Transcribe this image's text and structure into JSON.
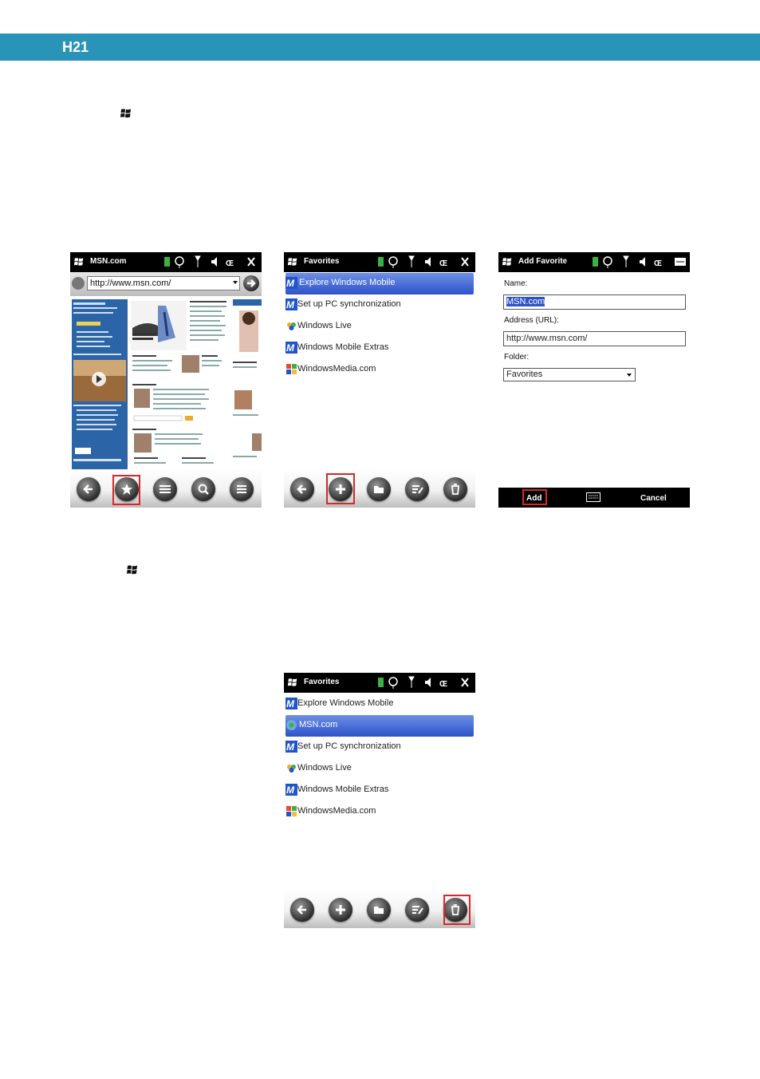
{
  "header": {
    "title": "H21"
  },
  "screen1": {
    "title": "MSN.com",
    "address": "http://www.msn.com/"
  },
  "screen2": {
    "title": "Favorites",
    "items": [
      "Explore Windows Mobile",
      "Set up PC synchronization",
      "Windows Live",
      "Windows Mobile Extras",
      "WindowsMedia.com"
    ]
  },
  "screen3": {
    "title": "Add Favorite",
    "name_label": "Name:",
    "name_value": "MSN.com",
    "address_label": "Address (URL):",
    "address_value": "http://www.msn.com/",
    "folder_label": "Folder:",
    "folder_value": "Favorites",
    "softkey_left": "Add",
    "softkey_right": "Cancel"
  },
  "screen4": {
    "title": "Favorites",
    "items": [
      "Explore Windows Mobile",
      "MSN.com",
      "Set up PC synchronization",
      "Windows Live",
      "Windows Mobile Extras",
      "WindowsMedia.com"
    ]
  },
  "colors": {
    "header_bar": "#2a93b8",
    "highlight": "#d9262a",
    "selection": "#2d53c9"
  },
  "icons": [
    "windows-start-icon",
    "back-icon",
    "favorites-star-icon",
    "add-icon",
    "folder-icon",
    "edit-icon",
    "delete-icon",
    "zoom-icon",
    "menu-icon",
    "keyboard-icon"
  ]
}
